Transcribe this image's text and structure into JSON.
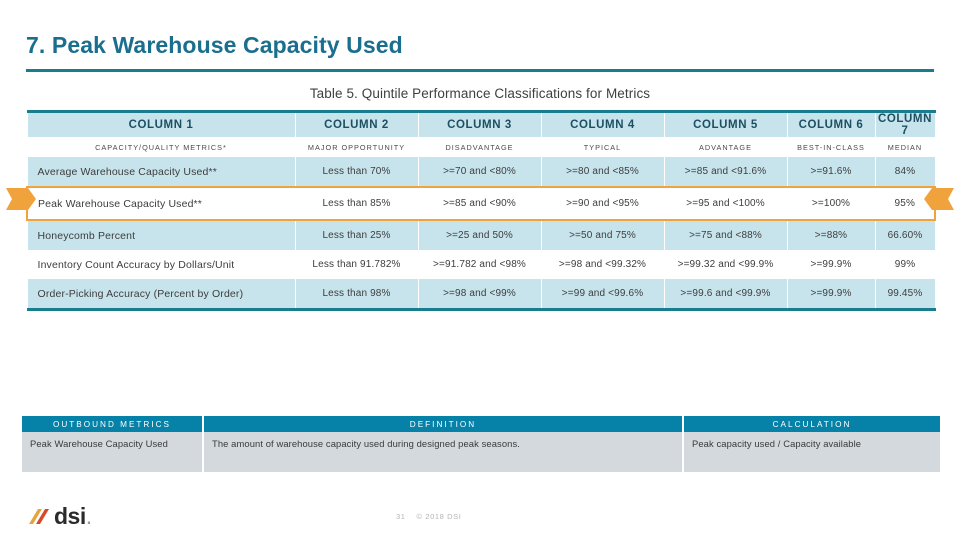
{
  "slide": {
    "title": "7. Peak Warehouse Capacity Used",
    "page_number": "31",
    "copyright": "© 2018 DSI",
    "accent_teal": "#197d8f",
    "title_color": "#1a6e8e",
    "band_blue": "#c7e4ec",
    "highlight_orange": "#f0a33c",
    "header_blue": "#0682a8",
    "def_row_gray": "#d3d9dc"
  },
  "logo": {
    "text": "dsi",
    "dot": "."
  },
  "quintile_table": {
    "caption": "Table 5. Quintile Performance Classifications for Metrics",
    "column_headers": [
      "COLUMN 1",
      "COLUMN 2",
      "COLUMN 3",
      "COLUMN 4",
      "COLUMN 5",
      "COLUMN 6",
      "COLUMN 7"
    ],
    "sub_headers": [
      "CAPACITY/QUALITY METRICS*",
      "MAJOR OPPORTUNITY",
      "DISADVANTAGE",
      "TYPICAL",
      "ADVANTAGE",
      "BEST-IN-CLASS",
      "MEDIAN"
    ],
    "rows": [
      {
        "highlighted": false,
        "shade": "blue",
        "cells": [
          "Average Warehouse Capacity Used**",
          "Less than 70%",
          ">=70 and <80%",
          ">=80 and <85%",
          ">=85 and <91.6%",
          ">=91.6%",
          "84%"
        ]
      },
      {
        "highlighted": true,
        "shade": "white",
        "cells": [
          "Peak Warehouse Capacity Used**",
          "Less than 85%",
          ">=85 and <90%",
          ">=90 and <95%",
          ">=95 and <100%",
          ">=100%",
          "95%"
        ]
      },
      {
        "highlighted": false,
        "shade": "blue",
        "cells": [
          "Honeycomb Percent",
          "Less than 25%",
          ">=25 and 50%",
          ">=50 and 75%",
          ">=75 and <88%",
          ">=88%",
          "66.60%"
        ]
      },
      {
        "highlighted": false,
        "shade": "white",
        "cells": [
          "Inventory Count Accuracy by Dollars/Unit",
          "Less than 91.782%",
          ">=91.782 and <98%",
          ">=98 and <99.32%",
          ">=99.32 and <99.9%",
          ">=99.9%",
          "99%"
        ]
      },
      {
        "highlighted": false,
        "shade": "blue",
        "cells": [
          "Order-Picking Accuracy (Percent by Order)",
          "Less than 98%",
          ">=98 and <99%",
          ">=99 and <99.6%",
          ">=99.6 and <99.9%",
          ">=99.9%",
          "99.45%"
        ]
      }
    ]
  },
  "definition_table": {
    "headers": [
      "OUTBOUND METRICS",
      "DEFINITION",
      "CALCULATION"
    ],
    "row": {
      "metric": "Peak Warehouse Capacity Used",
      "definition": "The amount of warehouse capacity used during designed peak seasons.",
      "calculation": "Peak capacity used / Capacity available"
    }
  }
}
